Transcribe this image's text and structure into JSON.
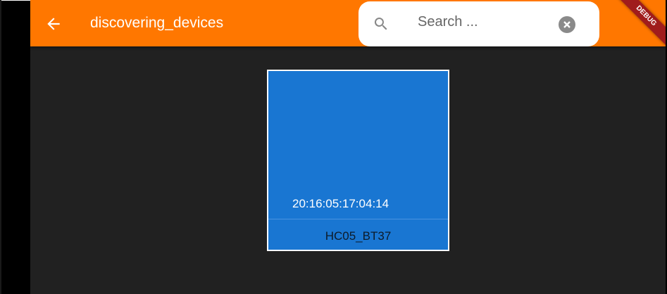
{
  "appbar": {
    "title": "discovering_devices",
    "search_placeholder": "Search ...",
    "debug_banner": "DEBUG",
    "color": "#ff7700"
  },
  "devices": [
    {
      "address": "20:16:05:17:04:14",
      "name": "HC05_BT37",
      "color": "#1976d2"
    }
  ]
}
